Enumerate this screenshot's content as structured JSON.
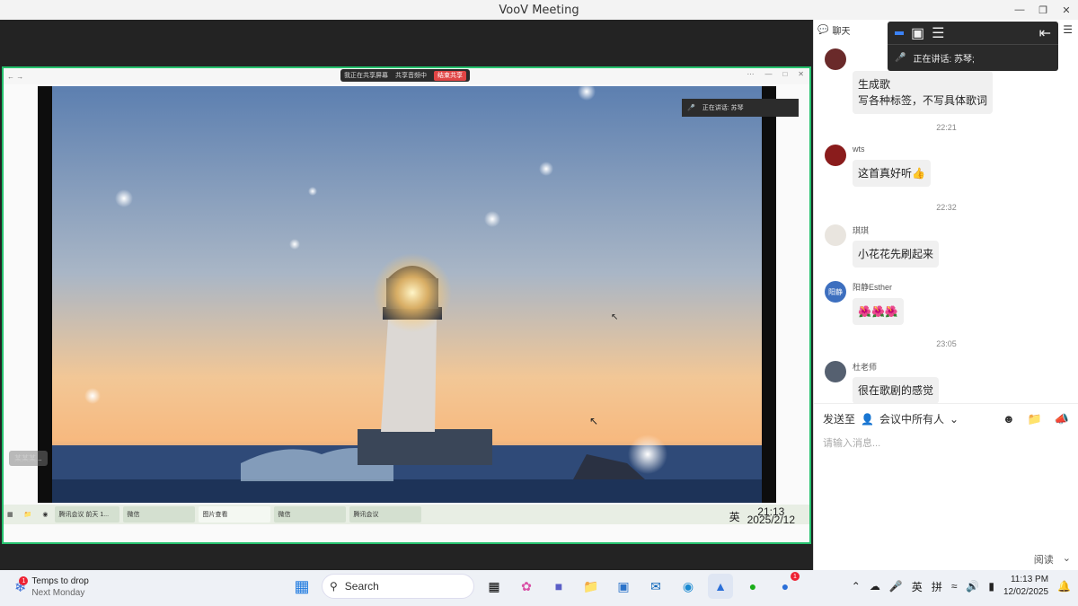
{
  "window": {
    "title": "VooV Meeting"
  },
  "shared_screen": {
    "banner_items": [
      "我正在共享屏幕",
      "共享音频中",
      "结束共享"
    ],
    "speaking": "正在讲话: 苏琴",
    "floating_label": "某某某...",
    "inner_taskbar": {
      "items": [
        "腾讯会议 前天 1...",
        "微信",
        "图片查看",
        "微信",
        "腾讯会议"
      ],
      "time": "21:13",
      "date": "2025/2/12",
      "lang": "英"
    }
  },
  "chat": {
    "header": "聊天",
    "speaking_popup": "正在讲话: 苏琴;",
    "messages": [
      {
        "sender": "",
        "lines": [
          "生成歌",
          "写各种标签，不写具体歌词"
        ]
      },
      {
        "time": "22:21"
      },
      {
        "sender": "wts",
        "lines": [
          "这首真好听👍"
        ]
      },
      {
        "time": "22:32"
      },
      {
        "sender": "琪琪",
        "lines": [
          "小花花先刷起来"
        ]
      },
      {
        "sender": "阳静Esther",
        "avatar_text": "阳静",
        "lines": [
          "🌺🌺🌺"
        ]
      },
      {
        "time": "23:05"
      },
      {
        "sender": "杜老师",
        "lines": [
          "很在歌剧的感觉"
        ]
      }
    ],
    "send_to_label": "发送至",
    "send_to_target": "会议中所有人",
    "input_placeholder": "请输入消息...",
    "bottom_text": "阅读"
  },
  "taskbar": {
    "weather_title": "Temps to drop",
    "weather_sub": "Next Monday",
    "weather_badge": "1",
    "search_label": "Search",
    "tray_lang1": "英",
    "tray_lang2": "拼",
    "time": "11:13 PM",
    "date": "12/02/2025",
    "app_badge": "1"
  }
}
